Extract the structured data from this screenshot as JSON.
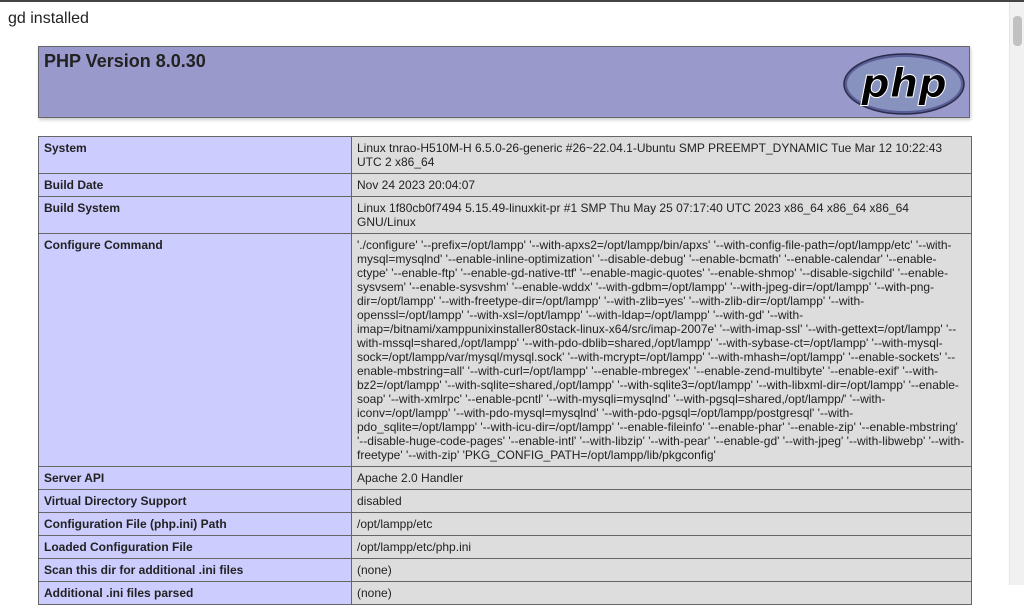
{
  "status_line": "gd installed",
  "header": {
    "title": "PHP Version 8.0.30",
    "logo": "php"
  },
  "rows": [
    {
      "label": "System",
      "value": "Linux tnrao-H510M-H 6.5.0-26-generic #26~22.04.1-Ubuntu SMP PREEMPT_DYNAMIC Tue Mar 12 10:22:43 UTC 2 x86_64"
    },
    {
      "label": "Build Date",
      "value": "Nov 24 2023 20:04:07"
    },
    {
      "label": "Build System",
      "value": "Linux 1f80cb0f7494 5.15.49-linuxkit-pr #1 SMP Thu May 25 07:17:40 UTC 2023 x86_64 x86_64 x86_64 GNU/Linux"
    },
    {
      "label": "Configure Command",
      "value": "'./configure' '--prefix=/opt/lampp' '--with-apxs2=/opt/lampp/bin/apxs' '--with-config-file-path=/opt/lampp/etc' '--with-mysql=mysqlnd' '--enable-inline-optimization' '--disable-debug' '--enable-bcmath' '--enable-calendar' '--enable-ctype' '--enable-ftp' '--enable-gd-native-ttf' '--enable-magic-quotes' '--enable-shmop' '--disable-sigchild' '--enable-sysvsem' '--enable-sysvshm' '--enable-wddx' '--with-gdbm=/opt/lampp' '--with-jpeg-dir=/opt/lampp' '--with-png-dir=/opt/lampp' '--with-freetype-dir=/opt/lampp' '--with-zlib=yes' '--with-zlib-dir=/opt/lampp' '--with-openssl=/opt/lampp' '--with-xsl=/opt/lampp' '--with-ldap=/opt/lampp' '--with-gd' '--with-imap=/bitnami/xamppunixinstaller80stack-linux-x64/src/imap-2007e' '--with-imap-ssl' '--with-gettext=/opt/lampp' '--with-mssql=shared,/opt/lampp' '--with-pdo-dblib=shared,/opt/lampp' '--with-sybase-ct=/opt/lampp' '--with-mysql-sock=/opt/lampp/var/mysql/mysql.sock' '--with-mcrypt=/opt/lampp' '--with-mhash=/opt/lampp' '--enable-sockets' '--enable-mbstring=all' '--with-curl=/opt/lampp' '--enable-mbregex' '--enable-zend-multibyte' '--enable-exif' '--with-bz2=/opt/lampp' '--with-sqlite=shared,/opt/lampp' '--with-sqlite3=/opt/lampp' '--with-libxml-dir=/opt/lampp' '--enable-soap' '--with-xmlrpc' '--enable-pcntl' '--with-mysqli=mysqlnd' '--with-pgsql=shared,/opt/lampp/' '--with-iconv=/opt/lampp' '--with-pdo-mysql=mysqlnd' '--with-pdo-pgsql=/opt/lampp/postgresql' '--with-pdo_sqlite=/opt/lampp' '--with-icu-dir=/opt/lampp' '--enable-fileinfo' '--enable-phar' '--enable-zip' '--enable-mbstring' '--disable-huge-code-pages' '--enable-intl' '--with-libzip' '--with-pear' '--enable-gd' '--with-jpeg' '--with-libwebp' '--with-freetype' '--with-zip' 'PKG_CONFIG_PATH=/opt/lampp/lib/pkgconfig'"
    },
    {
      "label": "Server API",
      "value": "Apache 2.0 Handler"
    },
    {
      "label": "Virtual Directory Support",
      "value": "disabled"
    },
    {
      "label": "Configuration File (php.ini) Path",
      "value": "/opt/lampp/etc"
    },
    {
      "label": "Loaded Configuration File",
      "value": "/opt/lampp/etc/php.ini"
    },
    {
      "label": "Scan this dir for additional .ini files",
      "value": "(none)"
    },
    {
      "label": "Additional .ini files parsed",
      "value": "(none)"
    }
  ],
  "colors": {
    "header_bg": "#9999cc",
    "label_bg": "#ccccff",
    "value_bg": "#dddddd"
  }
}
